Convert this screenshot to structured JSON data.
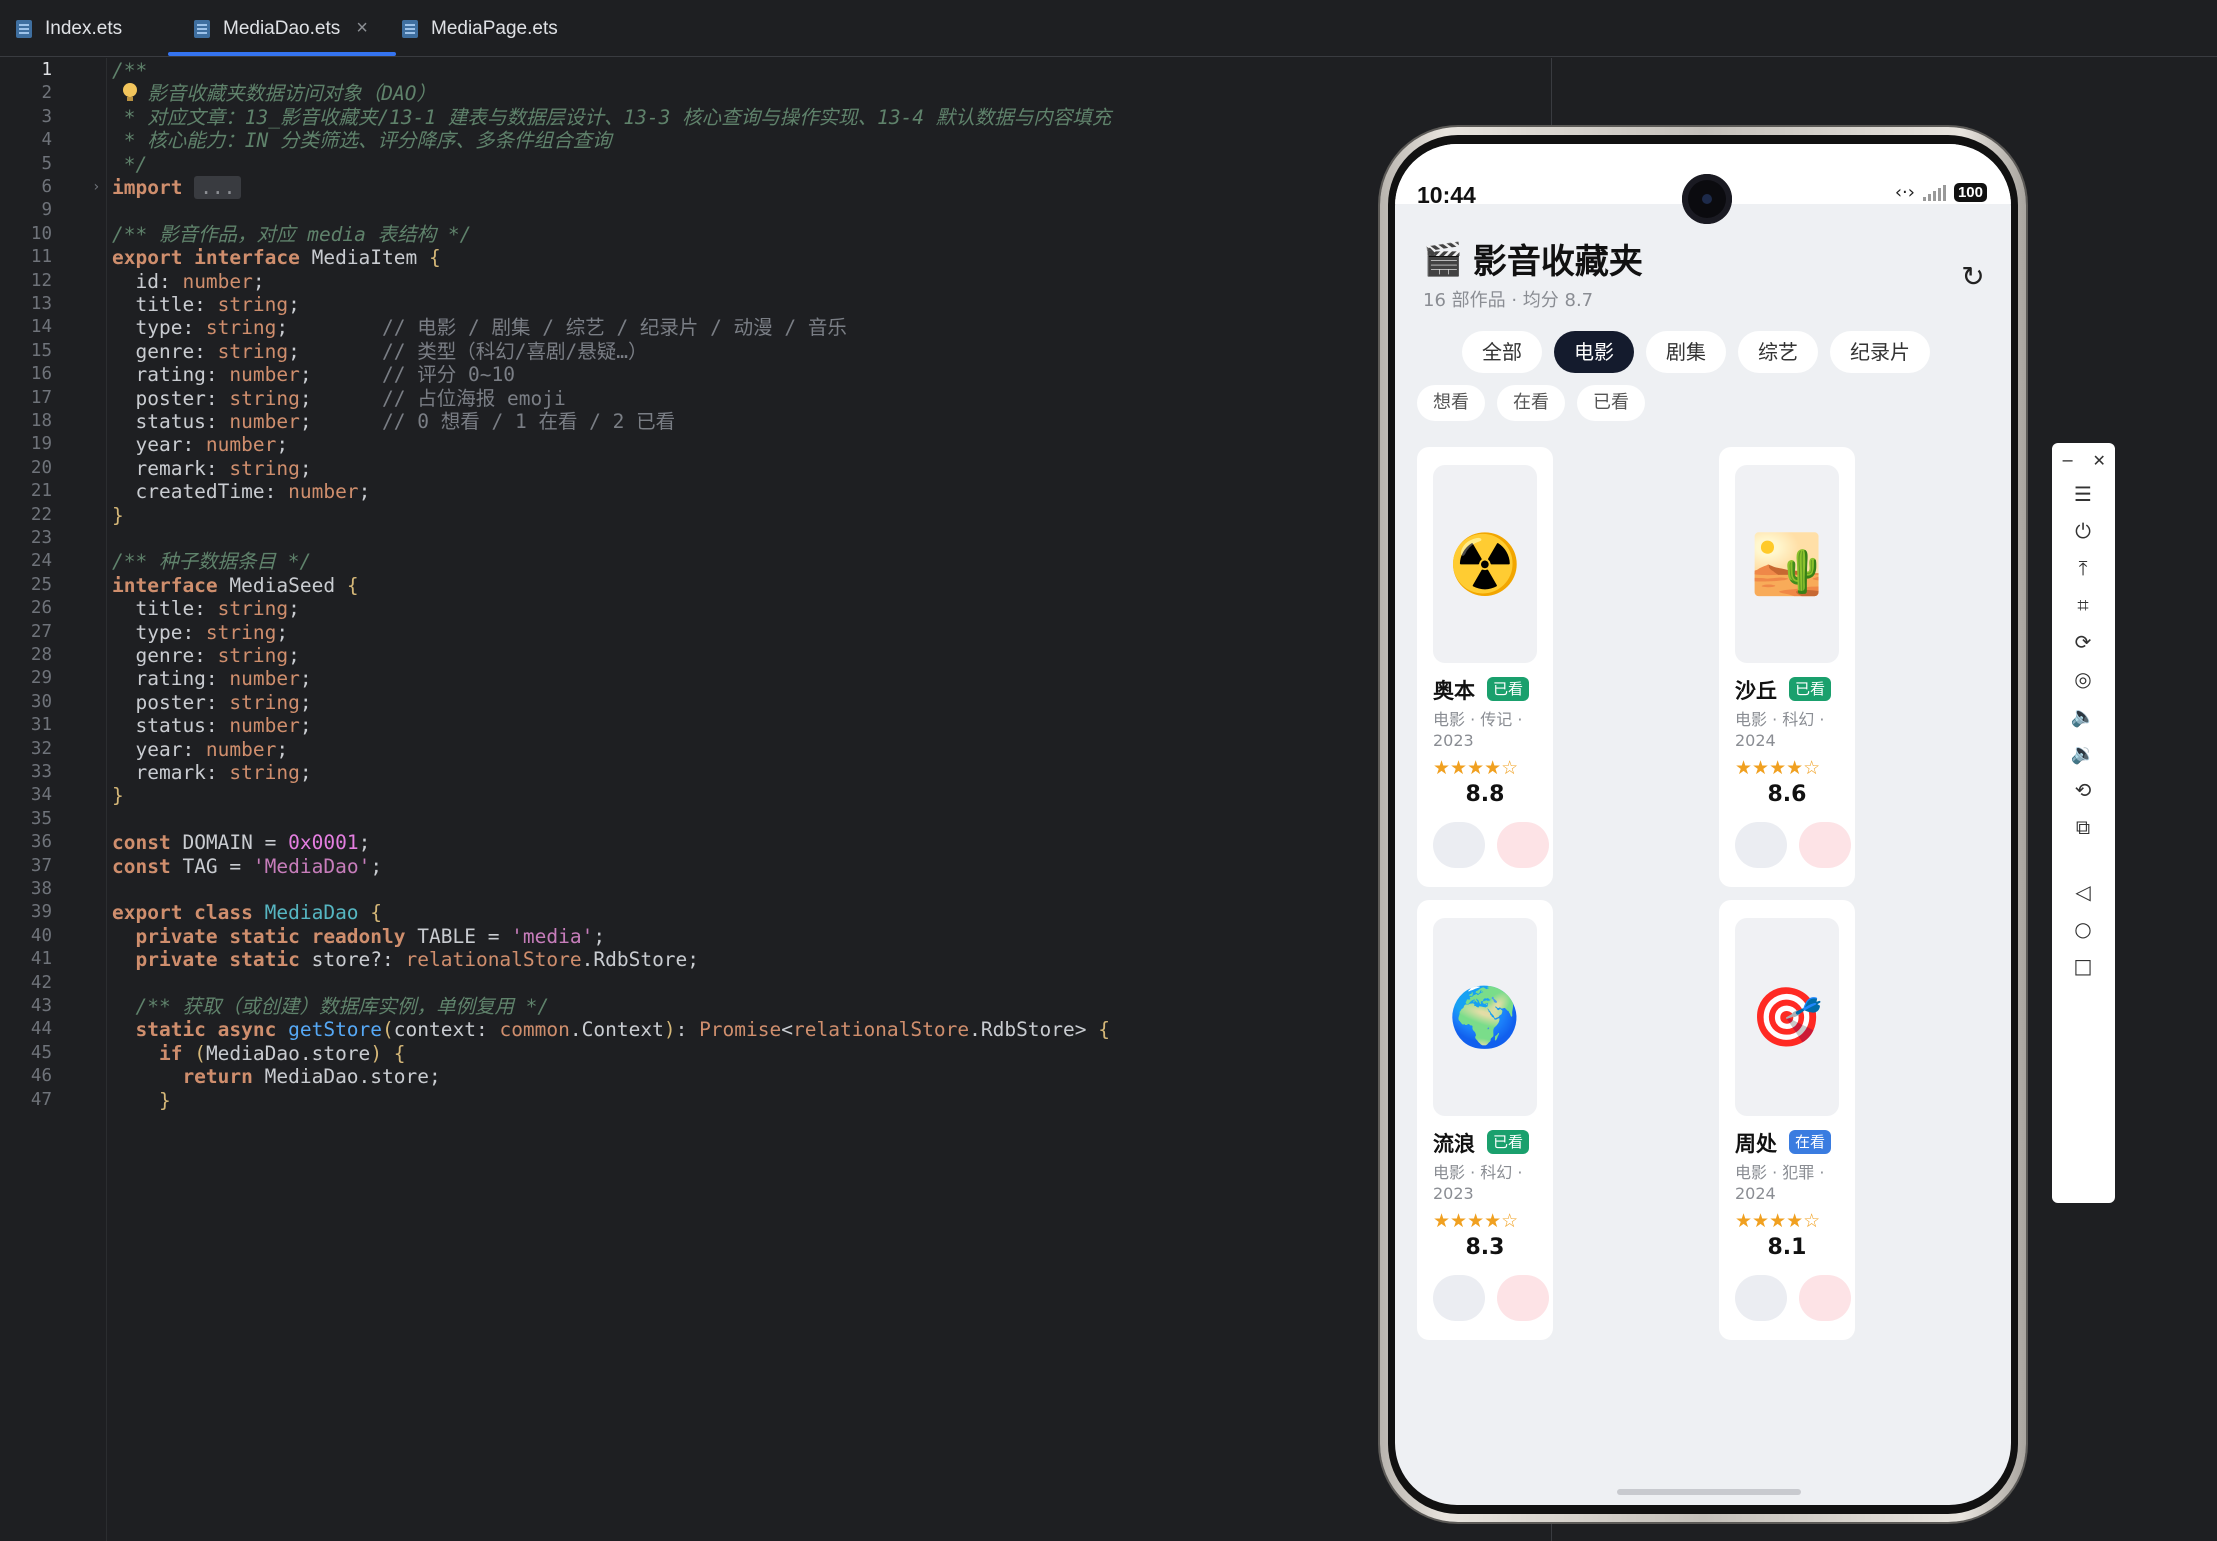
{
  "tabs": [
    {
      "label": "Index.ets",
      "active": false
    },
    {
      "label": "MediaDao.ets",
      "active": true,
      "closable": true
    },
    {
      "label": "MediaPage.ets",
      "active": false
    }
  ],
  "editor": {
    "lines": [
      {
        "n": "1",
        "current": true,
        "parts": [
          [
            "c-doc",
            "/**"
          ]
        ]
      },
      {
        "n": "2",
        "bulb": true,
        "parts": [
          [
            "c-doc",
            "   影音收藏夹数据访问对象（DAO）"
          ]
        ]
      },
      {
        "n": "3",
        "parts": [
          [
            "c-doc",
            " * 对应文章：13_影音收藏夹/13-1 建表与数据层设计、13-3 核心查询与操作实现、13-4 默认数据与内容填充"
          ]
        ]
      },
      {
        "n": "4",
        "parts": [
          [
            "c-doc",
            " * 核心能力：IN 分类筛选、评分降序、多条件组合查询"
          ]
        ]
      },
      {
        "n": "5",
        "parts": [
          [
            "c-doc",
            " */"
          ]
        ]
      },
      {
        "n": "6",
        "fold": true,
        "parts": [
          [
            "c-kw",
            "import "
          ],
          [
            "fold-import",
            "..."
          ]
        ]
      },
      {
        "n": "9",
        "parts": []
      },
      {
        "n": "10",
        "parts": [
          [
            "c-doc",
            "/** 影音作品，对应 media 表结构 */"
          ]
        ]
      },
      {
        "n": "11",
        "parts": [
          [
            "c-kw",
            "export interface "
          ],
          [
            "c-name",
            "MediaItem "
          ],
          [
            "c-brace",
            "{"
          ]
        ]
      },
      {
        "n": "12",
        "parts": [
          [
            "c-name",
            "  id: "
          ],
          [
            "c-type",
            "number"
          ],
          [
            "c-name",
            ";"
          ]
        ]
      },
      {
        "n": "13",
        "parts": [
          [
            "c-name",
            "  title: "
          ],
          [
            "c-type",
            "string"
          ],
          [
            "c-name",
            ";"
          ]
        ]
      },
      {
        "n": "14",
        "parts": [
          [
            "c-name",
            "  type: "
          ],
          [
            "c-type",
            "string"
          ],
          [
            "c-name",
            ";        "
          ],
          [
            "c-cmt",
            "// 电影 / 剧集 / 综艺 / 纪录片 / 动漫 / 音乐"
          ]
        ]
      },
      {
        "n": "15",
        "parts": [
          [
            "c-name",
            "  genre: "
          ],
          [
            "c-type",
            "string"
          ],
          [
            "c-name",
            ";       "
          ],
          [
            "c-cmt",
            "// 类型（科幻/喜剧/悬疑…）"
          ]
        ]
      },
      {
        "n": "16",
        "parts": [
          [
            "c-name",
            "  rating: "
          ],
          [
            "c-type",
            "number"
          ],
          [
            "c-name",
            ";      "
          ],
          [
            "c-cmt",
            "// 评分 0~10"
          ]
        ]
      },
      {
        "n": "17",
        "parts": [
          [
            "c-name",
            "  poster: "
          ],
          [
            "c-type",
            "string"
          ],
          [
            "c-name",
            ";      "
          ],
          [
            "c-cmt",
            "// 占位海报 emoji"
          ]
        ]
      },
      {
        "n": "18",
        "parts": [
          [
            "c-name",
            "  status: "
          ],
          [
            "c-type",
            "number"
          ],
          [
            "c-name",
            ";      "
          ],
          [
            "c-cmt",
            "// 0 想看 / 1 在看 / 2 已看"
          ]
        ]
      },
      {
        "n": "19",
        "parts": [
          [
            "c-name",
            "  year: "
          ],
          [
            "c-type",
            "number"
          ],
          [
            "c-name",
            ";"
          ]
        ]
      },
      {
        "n": "20",
        "parts": [
          [
            "c-name",
            "  remark: "
          ],
          [
            "c-type",
            "string"
          ],
          [
            "c-name",
            ";"
          ]
        ]
      },
      {
        "n": "21",
        "parts": [
          [
            "c-name",
            "  createdTime: "
          ],
          [
            "c-type",
            "number"
          ],
          [
            "c-name",
            ";"
          ]
        ]
      },
      {
        "n": "22",
        "parts": [
          [
            "c-brace",
            "}"
          ]
        ]
      },
      {
        "n": "23",
        "parts": []
      },
      {
        "n": "24",
        "parts": [
          [
            "c-doc",
            "/** 种子数据条目 */"
          ]
        ]
      },
      {
        "n": "25",
        "parts": [
          [
            "c-kw",
            "interface "
          ],
          [
            "c-name",
            "MediaSeed "
          ],
          [
            "c-brace",
            "{"
          ]
        ]
      },
      {
        "n": "26",
        "parts": [
          [
            "c-name",
            "  title: "
          ],
          [
            "c-type",
            "string"
          ],
          [
            "c-name",
            ";"
          ]
        ]
      },
      {
        "n": "27",
        "parts": [
          [
            "c-name",
            "  type: "
          ],
          [
            "c-type",
            "string"
          ],
          [
            "c-name",
            ";"
          ]
        ]
      },
      {
        "n": "28",
        "parts": [
          [
            "c-name",
            "  genre: "
          ],
          [
            "c-type",
            "string"
          ],
          [
            "c-name",
            ";"
          ]
        ]
      },
      {
        "n": "29",
        "parts": [
          [
            "c-name",
            "  rating: "
          ],
          [
            "c-type",
            "number"
          ],
          [
            "c-name",
            ";"
          ]
        ]
      },
      {
        "n": "30",
        "parts": [
          [
            "c-name",
            "  poster: "
          ],
          [
            "c-type",
            "string"
          ],
          [
            "c-name",
            ";"
          ]
        ]
      },
      {
        "n": "31",
        "parts": [
          [
            "c-name",
            "  status: "
          ],
          [
            "c-type",
            "number"
          ],
          [
            "c-name",
            ";"
          ]
        ]
      },
      {
        "n": "32",
        "parts": [
          [
            "c-name",
            "  year: "
          ],
          [
            "c-type",
            "number"
          ],
          [
            "c-name",
            ";"
          ]
        ]
      },
      {
        "n": "33",
        "parts": [
          [
            "c-name",
            "  remark: "
          ],
          [
            "c-type",
            "string"
          ],
          [
            "c-name",
            ";"
          ]
        ]
      },
      {
        "n": "34",
        "parts": [
          [
            "c-brace",
            "}"
          ]
        ]
      },
      {
        "n": "35",
        "parts": []
      },
      {
        "n": "36",
        "parts": [
          [
            "c-kw",
            "const "
          ],
          [
            "c-name",
            "DOMAIN = "
          ],
          [
            "c-hex",
            "0x0001"
          ],
          [
            "c-name",
            ";"
          ]
        ]
      },
      {
        "n": "37",
        "parts": [
          [
            "c-kw",
            "const "
          ],
          [
            "c-name",
            "TAG = "
          ],
          [
            "c-str",
            "'MediaDao'"
          ],
          [
            "c-name",
            ";"
          ]
        ]
      },
      {
        "n": "38",
        "parts": []
      },
      {
        "n": "39",
        "parts": [
          [
            "c-kw",
            "export class "
          ],
          [
            "c-cls",
            "MediaDao "
          ],
          [
            "c-brace",
            "{"
          ]
        ]
      },
      {
        "n": "40",
        "parts": [
          [
            "c-kw",
            "  private static readonly "
          ],
          [
            "c-name",
            "TABLE = "
          ],
          [
            "c-str",
            "'media'"
          ],
          [
            "c-name",
            ";"
          ]
        ]
      },
      {
        "n": "41",
        "parts": [
          [
            "c-kw",
            "  private static "
          ],
          [
            "c-name",
            "store?: "
          ],
          [
            "c-ns",
            "relationalStore"
          ],
          [
            "c-name",
            ".RdbStore;"
          ]
        ]
      },
      {
        "n": "42",
        "parts": []
      },
      {
        "n": "43",
        "parts": [
          [
            "c-doc",
            "  /** 获取（或创建）数据库实例，单例复用 */"
          ]
        ]
      },
      {
        "n": "44",
        "parts": [
          [
            "c-kw",
            "  static async "
          ],
          [
            "c-fn",
            "getStore"
          ],
          [
            "c-brace",
            "("
          ],
          [
            "c-name",
            "context: "
          ],
          [
            "c-ns",
            "common"
          ],
          [
            "c-name",
            ".Context"
          ],
          [
            "c-brace",
            ")"
          ],
          [
            "c-name",
            ": "
          ],
          [
            "c-type",
            "Promise"
          ],
          [
            "c-name",
            "<"
          ],
          [
            "c-ns",
            "relationalStore"
          ],
          [
            "c-name",
            ".RdbStore> "
          ],
          [
            "c-brace",
            "{"
          ]
        ]
      },
      {
        "n": "45",
        "parts": [
          [
            "c-kw",
            "    if "
          ],
          [
            "c-brace",
            "("
          ],
          [
            "c-name",
            "MediaDao.store"
          ],
          [
            "c-brace",
            ") {"
          ]
        ]
      },
      {
        "n": "46",
        "parts": [
          [
            "c-kw",
            "      return "
          ],
          [
            "c-name",
            "MediaDao.store;"
          ]
        ]
      },
      {
        "n": "47",
        "parts": [
          [
            "c-brace",
            "    }"
          ]
        ]
      }
    ]
  },
  "phone": {
    "time": "10:44",
    "battery": "100",
    "app_icon": "clapper-board-icon",
    "title": "影音收藏夹",
    "subtitle": "16 部作品 · 均分 8.7",
    "type_filters": [
      {
        "label": "全部",
        "selected": false
      },
      {
        "label": "电影",
        "selected": true
      },
      {
        "label": "剧集",
        "selected": false
      },
      {
        "label": "综艺",
        "selected": false
      },
      {
        "label": "纪录片",
        "selected": false
      }
    ],
    "status_filters": [
      "想看",
      "在看",
      "已看"
    ],
    "cards": [
      {
        "poster": "☢️",
        "poster_icon": "radioactive-icon",
        "title": "奥本",
        "badge": "已看",
        "badge_kind": "done",
        "meta": "电影 · 传记 · 2023",
        "stars": "★★★★☆",
        "score": "8.8"
      },
      {
        "poster": "🏜️",
        "poster_icon": "desert-icon",
        "title": "沙丘",
        "badge": "已看",
        "badge_kind": "done",
        "meta": "电影 · 科幻 · 2024",
        "stars": "★★★★☆",
        "score": "8.6"
      },
      {
        "poster": "🌍",
        "poster_icon": "globe-icon",
        "title": "流浪",
        "badge": "已看",
        "badge_kind": "done",
        "meta": "电影 · 科幻 · 2023",
        "stars": "★★★★☆",
        "score": "8.3"
      },
      {
        "poster": "🎯",
        "poster_icon": "target-icon",
        "title": "周处",
        "badge": "在看",
        "badge_kind": "doing",
        "meta": "电影 · 犯罪 · 2024",
        "stars": "★★★★☆",
        "score": "8.1"
      }
    ]
  },
  "emulator_toolbar": {
    "minimize": "−",
    "close": "✕",
    "tools": [
      "menu-icon",
      "power-icon",
      "pin-top-icon",
      "crop-icon",
      "rotate-icon",
      "screenshot-icon",
      "volume-up-icon",
      "volume-down-icon",
      "shake-icon",
      "multi-device-icon",
      "back-icon",
      "home-icon",
      "recents-icon"
    ]
  },
  "colors": {
    "editor_bg": "#1e1f22",
    "accent": "#3574f0",
    "badge_done": "#1aa06d",
    "badge_doing": "#3a7ce0",
    "chip_selected": "#141b2d",
    "star": "#f0a020"
  }
}
